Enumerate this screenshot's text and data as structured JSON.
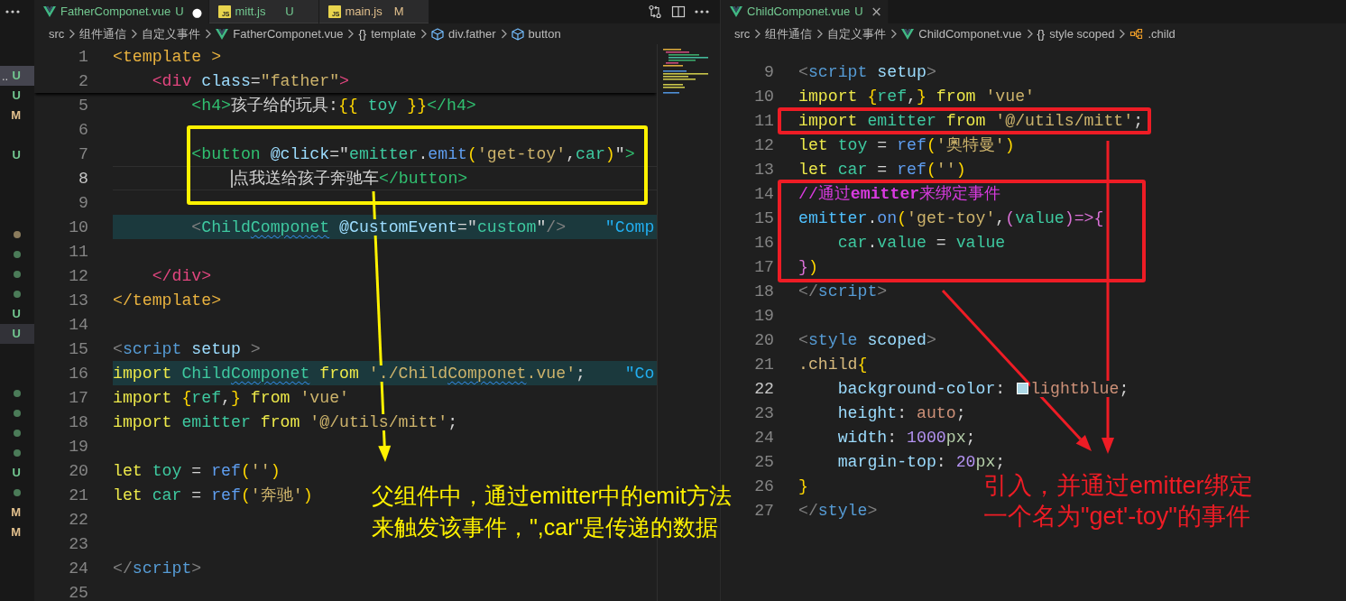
{
  "sidebar": {
    "groups": [
      [
        {
          "kind": "untracked",
          "label": "..",
          "text": "U",
          "selected": true,
          "hovered": false
        },
        {
          "kind": "untracked",
          "text": "U",
          "selected": false,
          "hovered": false
        },
        {
          "kind": "modified",
          "text": "M",
          "selected": false,
          "hovered": false
        }
      ],
      [
        {
          "kind": "untracked",
          "text": "U",
          "selected": false,
          "hovered": false
        }
      ],
      [
        {
          "kind": "dot",
          "color": "#8a7b5c",
          "selected": false,
          "hovered": false
        },
        {
          "kind": "dot",
          "color": "#4b7b58",
          "selected": false,
          "hovered": false
        },
        {
          "kind": "dot",
          "color": "#4b7b58",
          "selected": false,
          "hovered": false
        },
        {
          "kind": "dot",
          "color": "#4b7b58",
          "selected": false,
          "hovered": false
        },
        {
          "kind": "untracked",
          "text": "U",
          "selected": false,
          "hovered": false
        },
        {
          "kind": "untracked",
          "text": "U",
          "selected": false,
          "hovered": true
        }
      ],
      [
        {
          "kind": "dot",
          "color": "#4b7b58",
          "selected": false,
          "hovered": false
        },
        {
          "kind": "dot",
          "color": "#4b7b58",
          "selected": false,
          "hovered": false
        },
        {
          "kind": "dot",
          "color": "#4b7b58",
          "selected": false,
          "hovered": false
        },
        {
          "kind": "dot",
          "color": "#4b7b58",
          "selected": false,
          "hovered": false
        },
        {
          "kind": "untracked",
          "text": "U",
          "selected": false,
          "hovered": false
        },
        {
          "kind": "dot",
          "color": "#4b7b58",
          "selected": false,
          "hovered": false
        },
        {
          "kind": "modified",
          "text": "M",
          "selected": false,
          "hovered": false
        },
        {
          "kind": "modified",
          "text": "M",
          "selected": false,
          "hovered": false
        }
      ]
    ]
  },
  "editors": [
    {
      "focused": true,
      "show_actions": true,
      "show_minimap": true,
      "tabs": [
        {
          "kind": "vue",
          "label": "FatherComponet.vue",
          "color": "#73c991",
          "status": "U",
          "trailing": {
            "kind": "unsaved",
            "glyph": "●"
          },
          "selected": true
        },
        {
          "kind": "js",
          "badge": "JS",
          "label": "mitt.js",
          "color": "#73c991",
          "status": "U",
          "selected": false
        },
        {
          "kind": "js",
          "badge": "JS",
          "label": "main.js",
          "color": "#e2c08d",
          "status": "M",
          "selected": false
        }
      ],
      "breadcrumbs": [
        {
          "kind": "folder",
          "text": "src"
        },
        {
          "kind": "folder",
          "text": "组件通信"
        },
        {
          "kind": "folder",
          "text": "自定义事件"
        },
        {
          "kind": "vue",
          "text": "FatherComponet.vue"
        },
        {
          "kind": "symbol",
          "glyph": "{}",
          "text": "template"
        },
        {
          "kind": "element",
          "text": "div.father"
        },
        {
          "kind": "element",
          "text": "button"
        }
      ],
      "sticky_lines": [
        {
          "number": "1",
          "current": false,
          "highlighted": false,
          "tokens": [
            {
              "text": "<template >",
              "kind": "tag1"
            }
          ]
        },
        {
          "number": "2",
          "current": false,
          "highlighted": false,
          "tokens": [
            {
              "text": "    <div",
              "kind": "tag2"
            },
            {
              "text": " class",
              "kind": "attr"
            },
            {
              "text": "=",
              "kind": "punct"
            },
            {
              "text": "\"father\"",
              "kind": "str"
            },
            {
              "text": ">",
              "kind": "tag2"
            }
          ]
        }
      ],
      "lines": [
        {
          "number": "5",
          "current": false,
          "highlighted": false,
          "tokens": [
            {
              "text": "        <h4>",
              "kind": "tag3"
            },
            {
              "text": "孩子给的玩具:",
              "kind": "text"
            },
            {
              "text": "{{",
              "kind": "brace"
            },
            {
              "text": " toy ",
              "kind": "ident"
            },
            {
              "text": "}}",
              "kind": "brace"
            },
            {
              "text": "</h4>",
              "kind": "tag3"
            }
          ]
        },
        {
          "number": "6",
          "current": false,
          "highlighted": false
        },
        {
          "number": "7",
          "current": false,
          "highlighted": false,
          "tokens": [
            {
              "text": "        <button",
              "kind": "tag3"
            },
            {
              "text": " @click",
              "kind": "attr"
            },
            {
              "text": "=\"",
              "kind": "punct"
            },
            {
              "text": "emitter",
              "kind": "ident"
            },
            {
              "text": ".",
              "kind": "punct"
            },
            {
              "text": "emit",
              "kind": "fn"
            },
            {
              "text": "(",
              "kind": "brace"
            },
            {
              "text": "'get-toy'",
              "kind": "str"
            },
            {
              "text": ",",
              "kind": "punct"
            },
            {
              "text": "car",
              "kind": "ident"
            },
            {
              "text": ")",
              "kind": "brace"
            },
            {
              "text": "\"",
              "kind": "punct"
            },
            {
              "text": ">",
              "kind": "tag3"
            }
          ]
        },
        {
          "number": "8",
          "current": true,
          "highlighted": false,
          "tokens": [
            {
              "text": "            点我送给孩子奔驰车",
              "kind": "text"
            },
            {
              "text": "</button>",
              "kind": "tag3"
            }
          ]
        },
        {
          "number": "9",
          "current": false,
          "highlighted": false
        },
        {
          "number": "10",
          "current": false,
          "highlighted": true,
          "tokens": [
            {
              "text": "        <",
              "kind": "tagmark"
            },
            {
              "text": "Child",
              "kind": "ident"
            },
            {
              "text": "Componet",
              "kind": "typo"
            },
            {
              "text": " @CustomEvent",
              "kind": "attr"
            },
            {
              "text": "=\"",
              "kind": "punct"
            },
            {
              "text": "custom",
              "kind": "ident"
            },
            {
              "text": "\"",
              "kind": "punct"
            },
            {
              "text": "/>",
              "kind": "tagmark"
            }
          ],
          "hint": "\"Comp"
        },
        {
          "number": "11",
          "current": false,
          "highlighted": false
        },
        {
          "number": "12",
          "current": false,
          "highlighted": false,
          "tokens": [
            {
              "text": "    </div>",
              "kind": "tag2"
            }
          ]
        },
        {
          "number": "13",
          "current": false,
          "highlighted": false,
          "tokens": [
            {
              "text": "</template>",
              "kind": "tag1"
            }
          ]
        },
        {
          "number": "14",
          "current": false,
          "highlighted": false
        },
        {
          "number": "15",
          "current": false,
          "highlighted": false,
          "tokens": [
            {
              "text": "<",
              "kind": "tagmark"
            },
            {
              "text": "script",
              "kind": "tagname"
            },
            {
              "text": " setup",
              "kind": "attr"
            },
            {
              "text": " >",
              "kind": "tagmark"
            }
          ]
        },
        {
          "number": "16",
          "current": false,
          "highlighted": true,
          "tokens": [
            {
              "text": "import",
              "kind": "kw"
            },
            {
              "text": " Child",
              "kind": "ident"
            },
            {
              "text": "Componet",
              "kind": "typo"
            },
            {
              "text": " from",
              "kind": "kw"
            },
            {
              "text": " './Child",
              "kind": "str"
            },
            {
              "text": "Componet",
              "kind": "strtypo"
            },
            {
              "text": ".vue'",
              "kind": "str"
            },
            {
              "text": ";",
              "kind": "punct"
            }
          ],
          "hint": "\"Co"
        },
        {
          "number": "17",
          "current": false,
          "highlighted": false,
          "tokens": [
            {
              "text": "import",
              "kind": "kw"
            },
            {
              "text": " {",
              "kind": "brace"
            },
            {
              "text": "ref",
              "kind": "ident"
            },
            {
              "text": ",",
              "kind": "punct"
            },
            {
              "text": "}",
              "kind": "brace"
            },
            {
              "text": " from",
              "kind": "kw"
            },
            {
              "text": " 'vue'",
              "kind": "str"
            }
          ]
        },
        {
          "number": "18",
          "current": false,
          "highlighted": false,
          "tokens": [
            {
              "text": "import",
              "kind": "kw"
            },
            {
              "text": " emitter",
              "kind": "ident"
            },
            {
              "text": " from",
              "kind": "kw"
            },
            {
              "text": " '@/utils/mitt'",
              "kind": "str"
            },
            {
              "text": ";",
              "kind": "punct"
            }
          ]
        },
        {
          "number": "19",
          "current": false,
          "highlighted": false
        },
        {
          "number": "20",
          "current": false,
          "highlighted": false,
          "tokens": [
            {
              "text": "let",
              "kind": "kw"
            },
            {
              "text": " toy",
              "kind": "ident"
            },
            {
              "text": " =",
              "kind": "punct"
            },
            {
              "text": " ref",
              "kind": "fn"
            },
            {
              "text": "(",
              "kind": "brace"
            },
            {
              "text": "''",
              "kind": "str"
            },
            {
              "text": ")",
              "kind": "brace"
            }
          ]
        },
        {
          "number": "21",
          "current": false,
          "highlighted": false,
          "tokens": [
            {
              "text": "let",
              "kind": "kw"
            },
            {
              "text": " car",
              "kind": "ident"
            },
            {
              "text": " =",
              "kind": "punct"
            },
            {
              "text": " ref",
              "kind": "fn"
            },
            {
              "text": "(",
              "kind": "brace"
            },
            {
              "text": "'奔驰'",
              "kind": "str"
            },
            {
              "text": ")",
              "kind": "brace"
            }
          ]
        },
        {
          "number": "22",
          "current": false,
          "highlighted": false
        },
        {
          "number": "23",
          "current": false,
          "highlighted": false
        },
        {
          "number": "24",
          "current": false,
          "highlighted": false,
          "tokens": [
            {
              "text": "</",
              "kind": "tagmark"
            },
            {
              "text": "script",
              "kind": "tagname"
            },
            {
              "text": ">",
              "kind": "tagmark"
            }
          ]
        },
        {
          "number": "25",
          "current": false,
          "highlighted": false
        }
      ]
    },
    {
      "focused": false,
      "show_actions": false,
      "show_minimap": false,
      "tabs": [
        {
          "kind": "vue",
          "label": "ChildComponet.vue",
          "color": "#73c991",
          "status": "U",
          "trailing": {
            "kind": "close",
            "glyph": "×"
          },
          "selected": true
        }
      ],
      "breadcrumbs": [
        {
          "kind": "folder",
          "text": "src"
        },
        {
          "kind": "folder",
          "text": "组件通信"
        },
        {
          "kind": "folder",
          "text": "自定义事件"
        },
        {
          "kind": "vue",
          "text": "ChildComponet.vue"
        },
        {
          "kind": "symbol",
          "glyph": "{}",
          "text": "style scoped"
        },
        {
          "kind": "class",
          "text": ".child"
        }
      ],
      "lines": [
        {
          "number": "9",
          "current": false,
          "highlighted": false,
          "tokens": [
            {
              "text": "<",
              "kind": "tagmark"
            },
            {
              "text": "script",
              "kind": "tagname"
            },
            {
              "text": " setup",
              "kind": "attr"
            },
            {
              "text": ">",
              "kind": "tagmark"
            }
          ]
        },
        {
          "number": "10",
          "current": false,
          "highlighted": false,
          "tokens": [
            {
              "text": "import",
              "kind": "kw"
            },
            {
              "text": " {",
              "kind": "brace"
            },
            {
              "text": "ref",
              "kind": "ident"
            },
            {
              "text": ",",
              "kind": "punct"
            },
            {
              "text": "}",
              "kind": "brace"
            },
            {
              "text": " from",
              "kind": "kw"
            },
            {
              "text": " 'vue'",
              "kind": "str"
            }
          ]
        },
        {
          "number": "11",
          "current": false,
          "highlighted": false,
          "tokens": [
            {
              "text": "import",
              "kind": "kw"
            },
            {
              "text": " emitter",
              "kind": "ident"
            },
            {
              "text": " from",
              "kind": "kw"
            },
            {
              "text": " '@/utils/mitt'",
              "kind": "str"
            },
            {
              "text": ";",
              "kind": "punct"
            }
          ]
        },
        {
          "number": "12",
          "current": false,
          "highlighted": false,
          "tokens": [
            {
              "text": "let",
              "kind": "kw"
            },
            {
              "text": " toy",
              "kind": "ident"
            },
            {
              "text": " =",
              "kind": "punct"
            },
            {
              "text": " ref",
              "kind": "fn"
            },
            {
              "text": "(",
              "kind": "brace"
            },
            {
              "text": "'奥特曼'",
              "kind": "str"
            },
            {
              "text": ")",
              "kind": "brace"
            }
          ]
        },
        {
          "number": "13",
          "current": false,
          "highlighted": false,
          "tokens": [
            {
              "text": "let",
              "kind": "kw"
            },
            {
              "text": " car",
              "kind": "ident"
            },
            {
              "text": " =",
              "kind": "punct"
            },
            {
              "text": " ref",
              "kind": "fn"
            },
            {
              "text": "(",
              "kind": "brace"
            },
            {
              "text": "''",
              "kind": "str"
            },
            {
              "text": ")",
              "kind": "brace"
            }
          ]
        },
        {
          "number": "14",
          "current": false,
          "highlighted": false,
          "tokens": [
            {
              "text": "//通过**emitter**来绑定事件",
              "kind": "comment"
            }
          ]
        },
        {
          "number": "15",
          "current": false,
          "highlighted": false,
          "tokens": [
            {
              "text": "emitter",
              "kind": "var"
            },
            {
              "text": ".",
              "kind": "punct"
            },
            {
              "text": "on",
              "kind": "fn"
            },
            {
              "text": "(",
              "kind": "brace"
            },
            {
              "text": "'get-toy'",
              "kind": "str"
            },
            {
              "text": ",",
              "kind": "punct"
            },
            {
              "text": "(",
              "kind": "brace2"
            },
            {
              "text": "value",
              "kind": "ident"
            },
            {
              "text": ")=>{",
              "kind": "brace2"
            }
          ]
        },
        {
          "number": "16",
          "current": false,
          "highlighted": false,
          "tokens": [
            {
              "text": "    car",
              "kind": "ident"
            },
            {
              "text": ".",
              "kind": "punct"
            },
            {
              "text": "value",
              "kind": "ident"
            },
            {
              "text": " = ",
              "kind": "punct"
            },
            {
              "text": "value",
              "kind": "ident"
            }
          ]
        },
        {
          "number": "17",
          "current": false,
          "highlighted": false,
          "tokens": [
            {
              "text": "}",
              "kind": "brace2"
            },
            {
              "text": ")",
              "kind": "brace"
            }
          ]
        },
        {
          "number": "18",
          "current": false,
          "highlighted": false,
          "tokens": [
            {
              "text": "</",
              "kind": "tagmark"
            },
            {
              "text": "script",
              "kind": "tagname"
            },
            {
              "text": ">",
              "kind": "tagmark"
            }
          ]
        },
        {
          "number": "19",
          "current": false,
          "highlighted": false
        },
        {
          "number": "20",
          "current": false,
          "highlighted": false,
          "tokens": [
            {
              "text": "<",
              "kind": "tagmark"
            },
            {
              "text": "style",
              "kind": "tagname"
            },
            {
              "text": " scoped",
              "kind": "attr"
            },
            {
              "text": ">",
              "kind": "tagmark"
            }
          ]
        },
        {
          "number": "21",
          "current": false,
          "highlighted": false,
          "tokens": [
            {
              "text": ".child",
              "kind": "selector"
            },
            {
              "text": "{",
              "kind": "brace"
            }
          ]
        },
        {
          "number": "22",
          "current": true,
          "highlighted": false,
          "tokens": [
            {
              "text": "    background-color",
              "kind": "prop"
            },
            {
              "text": ": ",
              "kind": "punct"
            },
            {
              "kind": "swatch",
              "color": "#add8e6"
            },
            {
              "text": "lightblue",
              "kind": "value"
            },
            {
              "text": ";",
              "kind": "punct"
            }
          ]
        },
        {
          "number": "23",
          "current": false,
          "highlighted": false,
          "tokens": [
            {
              "text": "    height",
              "kind": "prop"
            },
            {
              "text": ": ",
              "kind": "punct"
            },
            {
              "text": "auto",
              "kind": "value"
            },
            {
              "text": ";",
              "kind": "punct"
            }
          ]
        },
        {
          "number": "24",
          "current": false,
          "highlighted": false,
          "tokens": [
            {
              "text": "    width",
              "kind": "prop"
            },
            {
              "text": ": ",
              "kind": "punct"
            },
            {
              "text": "1000",
              "kind": "number"
            },
            {
              "text": "px",
              "kind": "unit"
            },
            {
              "text": ";",
              "kind": "punct"
            }
          ]
        },
        {
          "number": "25",
          "current": false,
          "highlighted": false,
          "tokens": [
            {
              "text": "    margin-top",
              "kind": "prop"
            },
            {
              "text": ": ",
              "kind": "punct"
            },
            {
              "text": "20",
              "kind": "number"
            },
            {
              "text": "px",
              "kind": "unit"
            },
            {
              "text": ";",
              "kind": "punct"
            }
          ]
        },
        {
          "number": "26",
          "current": false,
          "highlighted": false,
          "tokens": [
            {
              "text": "}",
              "kind": "brace"
            }
          ]
        },
        {
          "number": "27",
          "current": false,
          "highlighted": false,
          "tokens": [
            {
              "text": "</",
              "kind": "tagmark"
            },
            {
              "text": "style",
              "kind": "tagname"
            },
            {
              "text": ">",
              "kind": "tagmark"
            }
          ]
        }
      ]
    }
  ],
  "annotations": [
    {
      "kind": "box",
      "color": "#fff200"
    },
    {
      "kind": "arrow",
      "color": "#fff200"
    },
    {
      "kind": "note",
      "color": "#fff200",
      "lines": [
        "父组件中，通过emitter中的emit方法",
        "来触发该事件，\",car\"是传递的数据"
      ]
    },
    {
      "kind": "box",
      "color": "#ee1c25"
    },
    {
      "kind": "box",
      "color": "#ee1c25"
    },
    {
      "kind": "arrow",
      "color": "#ee1c25"
    },
    {
      "kind": "arrow",
      "color": "#ee1c25"
    },
    {
      "kind": "note",
      "color": "#ee1c25",
      "lines": [
        "引入，并通过emitter绑定",
        "一个名为\"get'-toy\"的事件"
      ]
    }
  ]
}
